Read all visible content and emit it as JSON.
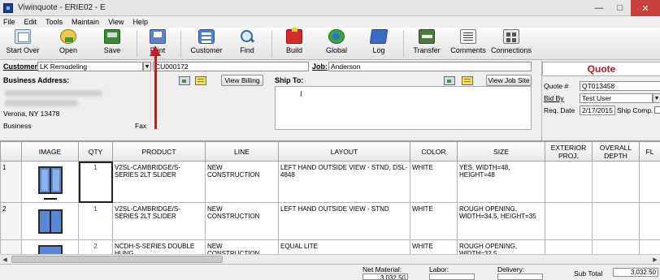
{
  "window": {
    "title": "Viwinquote - ERIE02 - E"
  },
  "menu": [
    "File",
    "Edit",
    "Tools",
    "Maintain",
    "View",
    "Help"
  ],
  "toolbar": [
    {
      "label": "Start Over",
      "icon": "start-over-icon"
    },
    {
      "label": "Open",
      "icon": "open-icon"
    },
    {
      "label": "Save",
      "icon": "save-icon"
    },
    {
      "label": "Print",
      "icon": "print-icon"
    },
    {
      "label": "Customer",
      "icon": "customer-icon"
    },
    {
      "label": "Find",
      "icon": "find-icon"
    },
    {
      "label": "Build",
      "icon": "build-icon"
    },
    {
      "label": "Global",
      "icon": "global-icon"
    },
    {
      "label": "Log",
      "icon": "log-icon"
    },
    {
      "label": "Transfer",
      "icon": "transfer-icon"
    },
    {
      "label": "Comments",
      "icon": "comments-icon"
    },
    {
      "label": "Connections",
      "icon": "connections-icon"
    }
  ],
  "form": {
    "customer_label": "Customer:",
    "customer_value": "LK Remodeling",
    "customer_code": "CU000172",
    "job_label": "Job:",
    "job_value": "Anderson",
    "business_address_label": "Business Address:",
    "address_city": "Verona, NY 13478",
    "business_label": "Business",
    "fax_label": "Fax",
    "view_billing": "View Billing",
    "ship_to_label": "Ship To:",
    "view_job_site": "View Job Site"
  },
  "quote": {
    "title": "Quote",
    "quote_no_label": "Quote #",
    "quote_no": "QT013458",
    "bid_by_label": "Bid By",
    "bid_by": "Test User",
    "req_date_label": "Req. Date",
    "req_date": "2/17/2015",
    "ship_comp_label": "Ship Comp."
  },
  "grid": {
    "headers": [
      "",
      "IMAGE",
      "QTY",
      "PRODUCT",
      "LINE",
      "LAYOUT",
      "COLOR",
      "SIZE",
      "EXTERIOR PROJ.",
      "OVERALL DEPTH",
      "FL"
    ],
    "rows": [
      {
        "num": "1",
        "qty": "1",
        "product": "V2SL-CAMBRIDGE/S-SERIES 2LT SLIDER",
        "line": "NEW CONSTRUCTION",
        "layout": "LEFT HAND OUTSIDE VIEW - STND, DSL-4848",
        "color": "WHITE",
        "size": "YES, WIDTH=48, HEIGHT=48"
      },
      {
        "num": "2",
        "qty": "1",
        "product": "V2SL-CAMBRIDGE/S-SERIES 2LT SLIDER",
        "line": "NEW CONSTRUCTION",
        "layout": "LEFT HAND OUTSIDE VIEW - STND",
        "color": "WHITE",
        "size": "ROUGH OPENING, WIDTH=34.5, HEIGHT=35"
      },
      {
        "num": "",
        "qty": "2",
        "product": "NCDH-S-SERIES DOUBLE HUNG",
        "line": "NEW CONSTRUCTION",
        "layout": "EQUAL LITE",
        "color": "WHITE",
        "size": "ROUGH OPENING, WIDTH=32.5"
      }
    ]
  },
  "footer": {
    "net_material_label": "Net Material:",
    "net_material": "3,032.50",
    "labor_label": "Labor:",
    "labor": "",
    "delivery_label": "Delivery:",
    "delivery": "",
    "sub_total_label": "Sub Total",
    "sub_total": "3,032.50"
  }
}
